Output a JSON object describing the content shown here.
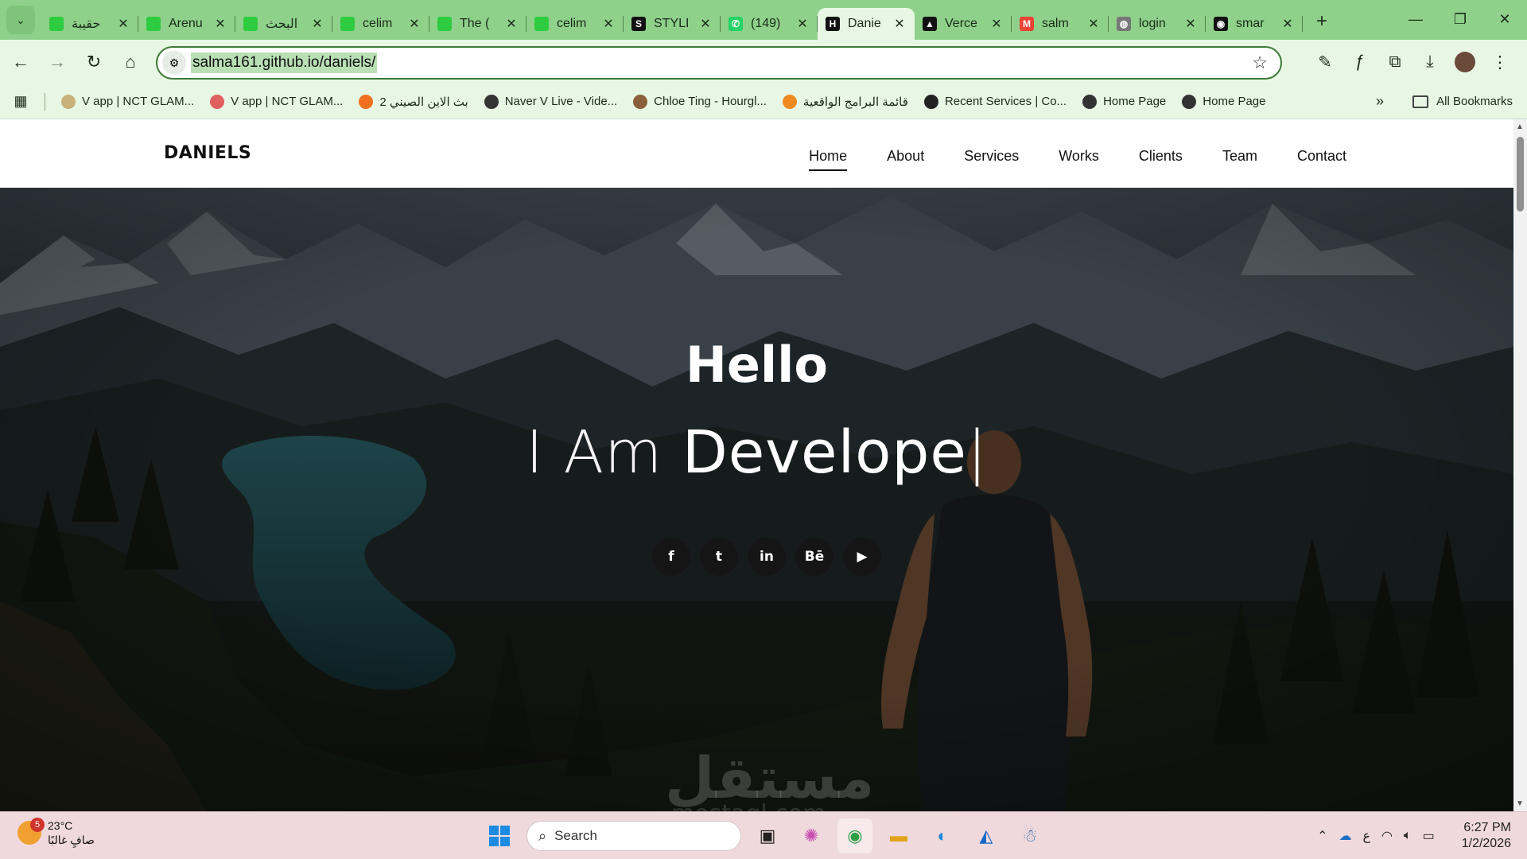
{
  "browser": {
    "tabs": [
      {
        "title": "حقيبة",
        "favicon_color": "#2ecc40",
        "favicon_glyph": ""
      },
      {
        "title": "Arenu",
        "favicon_color": "#2ecc40",
        "favicon_glyph": ""
      },
      {
        "title": "البحث",
        "favicon_color": "#2ecc40",
        "favicon_glyph": ""
      },
      {
        "title": "celim",
        "favicon_color": "#2ecc40",
        "favicon_glyph": ""
      },
      {
        "title": "The (",
        "favicon_color": "#2ecc40",
        "favicon_glyph": ""
      },
      {
        "title": "celim",
        "favicon_color": "#2ecc40",
        "favicon_glyph": ""
      },
      {
        "title": "STYLI",
        "favicon_color": "#111111",
        "favicon_glyph": "S"
      },
      {
        "title": "(149)",
        "favicon_color": "#25d366",
        "favicon_glyph": "✆"
      },
      {
        "title": "Danie",
        "favicon_color": "#111111",
        "favicon_glyph": "H",
        "active": true
      },
      {
        "title": "Verce",
        "favicon_color": "#111111",
        "favicon_glyph": "▲"
      },
      {
        "title": "salm",
        "favicon_color": "#ea4335",
        "favicon_glyph": "M"
      },
      {
        "title": "login",
        "favicon_color": "#777777",
        "favicon_glyph": "◍"
      },
      {
        "title": "smar",
        "favicon_color": "#111111",
        "favicon_glyph": "◉"
      }
    ],
    "url": "salma161.github.io/daniels/",
    "bookmarks": [
      {
        "label": "V app | NCT GLAM...",
        "icon_color": "#c8b27a"
      },
      {
        "label": "V app | NCT GLAM...",
        "icon_color": "#e06060"
      },
      {
        "label": "بث الاين الصيني 2",
        "icon_color": "#f07020"
      },
      {
        "label": "Naver V Live - Vide...",
        "icon_color": "#333333"
      },
      {
        "label": "Chloe Ting - Hourgl...",
        "icon_color": "#8b5e3c"
      },
      {
        "label": "قائمة البرامج الواقعية",
        "icon_color": "#f08a20"
      },
      {
        "label": "Recent Services | Co...",
        "icon_color": "#222222"
      },
      {
        "label": "Home Page",
        "icon_color": "#333333"
      },
      {
        "label": "Home Page",
        "icon_color": "#333333"
      }
    ],
    "all_bookmarks": "All Bookmarks",
    "more_bookmarks": "»"
  },
  "site": {
    "logo": "DANIELS",
    "nav": [
      {
        "label": "Home",
        "active": true
      },
      {
        "label": "About"
      },
      {
        "label": "Services"
      },
      {
        "label": "Works"
      },
      {
        "label": "Clients"
      },
      {
        "label": "Team"
      },
      {
        "label": "Contact"
      }
    ],
    "hero": {
      "greeting": "Hello",
      "prefix": "I Am",
      "typed_word": "Develope",
      "cursor": "|",
      "socials": [
        {
          "name": "facebook",
          "glyph": "f"
        },
        {
          "name": "twitter",
          "glyph": "t"
        },
        {
          "name": "linkedin",
          "glyph": "in"
        },
        {
          "name": "behance",
          "glyph": "Bē"
        },
        {
          "name": "youtube",
          "glyph": "▶"
        }
      ],
      "watermark": "مستقل",
      "watermark_sub": "mostaql.com"
    }
  },
  "taskbar": {
    "weather_temp": "23°C",
    "weather_desc": "صافٍ غالبًا",
    "weather_badge": "5",
    "search_label": "Search",
    "language": "ع",
    "time": "6:27 PM",
    "date": "1/2/2026"
  }
}
